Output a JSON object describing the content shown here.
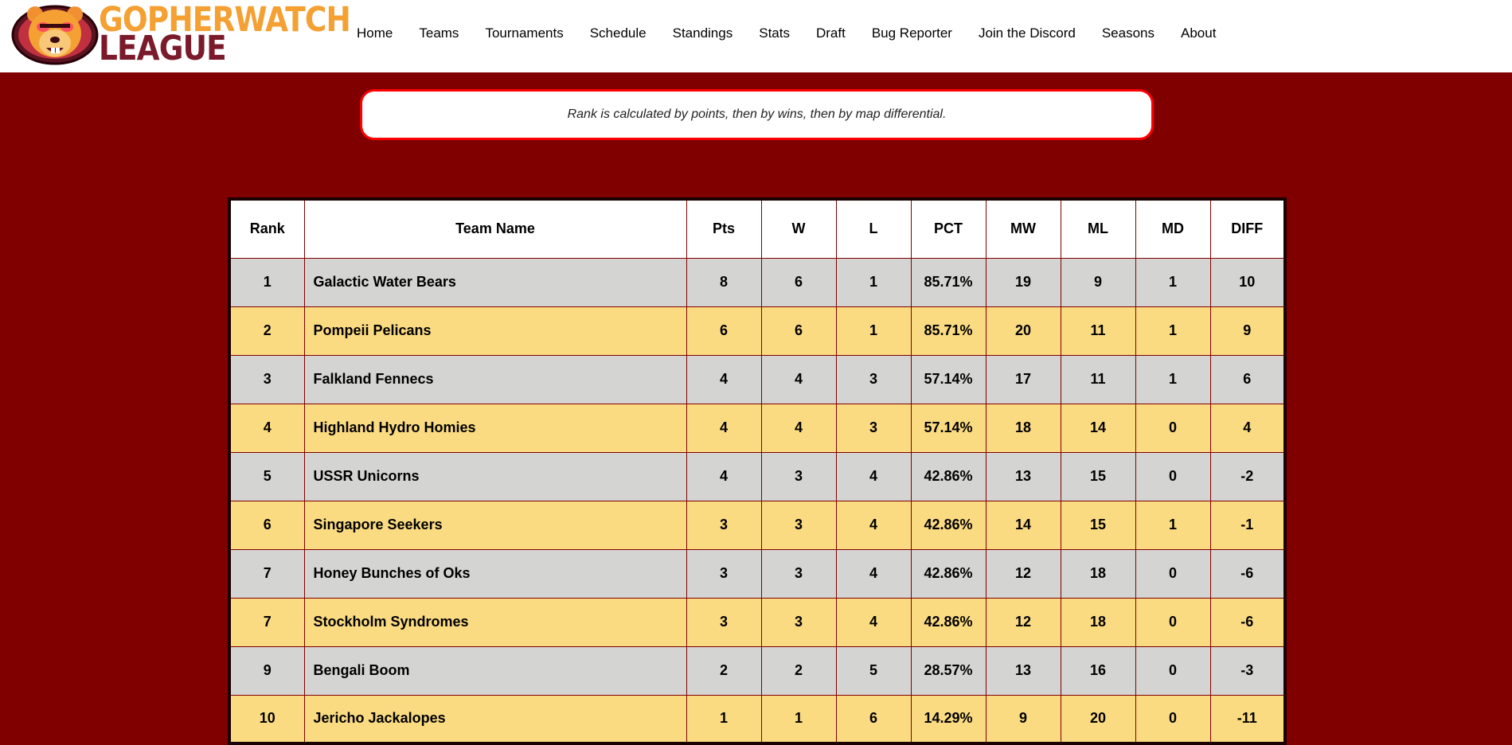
{
  "logo": {
    "line1": "GOPHERWATCH",
    "line2": "LEAGUE"
  },
  "nav": [
    {
      "label": "Home"
    },
    {
      "label": "Teams"
    },
    {
      "label": "Tournaments"
    },
    {
      "label": "Schedule"
    },
    {
      "label": "Standings"
    },
    {
      "label": "Stats"
    },
    {
      "label": "Draft"
    },
    {
      "label": "Bug Reporter"
    },
    {
      "label": "Join the Discord"
    },
    {
      "label": "Seasons"
    },
    {
      "label": "About"
    }
  ],
  "info": {
    "text": "Rank is calculated by points, then by wins, then by map differential."
  },
  "table": {
    "headers": [
      "Rank",
      "Team Name",
      "Pts",
      "W",
      "L",
      "PCT",
      "MW",
      "ML",
      "MD",
      "DIFF"
    ],
    "rows": [
      [
        "1",
        "Galactic Water Bears",
        "8",
        "6",
        "1",
        "85.71%",
        "19",
        "9",
        "1",
        "10"
      ],
      [
        "2",
        "Pompeii Pelicans",
        "6",
        "6",
        "1",
        "85.71%",
        "20",
        "11",
        "1",
        "9"
      ],
      [
        "3",
        "Falkland Fennecs",
        "4",
        "4",
        "3",
        "57.14%",
        "17",
        "11",
        "1",
        "6"
      ],
      [
        "4",
        "Highland Hydro Homies",
        "4",
        "4",
        "3",
        "57.14%",
        "18",
        "14",
        "0",
        "4"
      ],
      [
        "5",
        "USSR Unicorns",
        "4",
        "3",
        "4",
        "42.86%",
        "13",
        "15",
        "0",
        "-2"
      ],
      [
        "6",
        "Singapore Seekers",
        "3",
        "3",
        "4",
        "42.86%",
        "14",
        "15",
        "1",
        "-1"
      ],
      [
        "7",
        "Honey Bunches of Oks",
        "3",
        "3",
        "4",
        "42.86%",
        "12",
        "18",
        "0",
        "-6"
      ],
      [
        "7",
        "Stockholm Syndromes",
        "3",
        "3",
        "4",
        "42.86%",
        "12",
        "18",
        "0",
        "-6"
      ],
      [
        "9",
        "Bengali Boom",
        "2",
        "2",
        "5",
        "28.57%",
        "13",
        "16",
        "0",
        "-3"
      ],
      [
        "10",
        "Jericho Jackalopes",
        "1",
        "1",
        "6",
        "14.29%",
        "9",
        "20",
        "0",
        "-11"
      ]
    ]
  },
  "colors": {
    "background": "#800000",
    "row_gray": "#d4d4d2",
    "row_yellow": "#fbdb82",
    "logo_orange": "#f4a032",
    "logo_maroon": "#7a1a2a",
    "info_border": "#ff0000"
  }
}
